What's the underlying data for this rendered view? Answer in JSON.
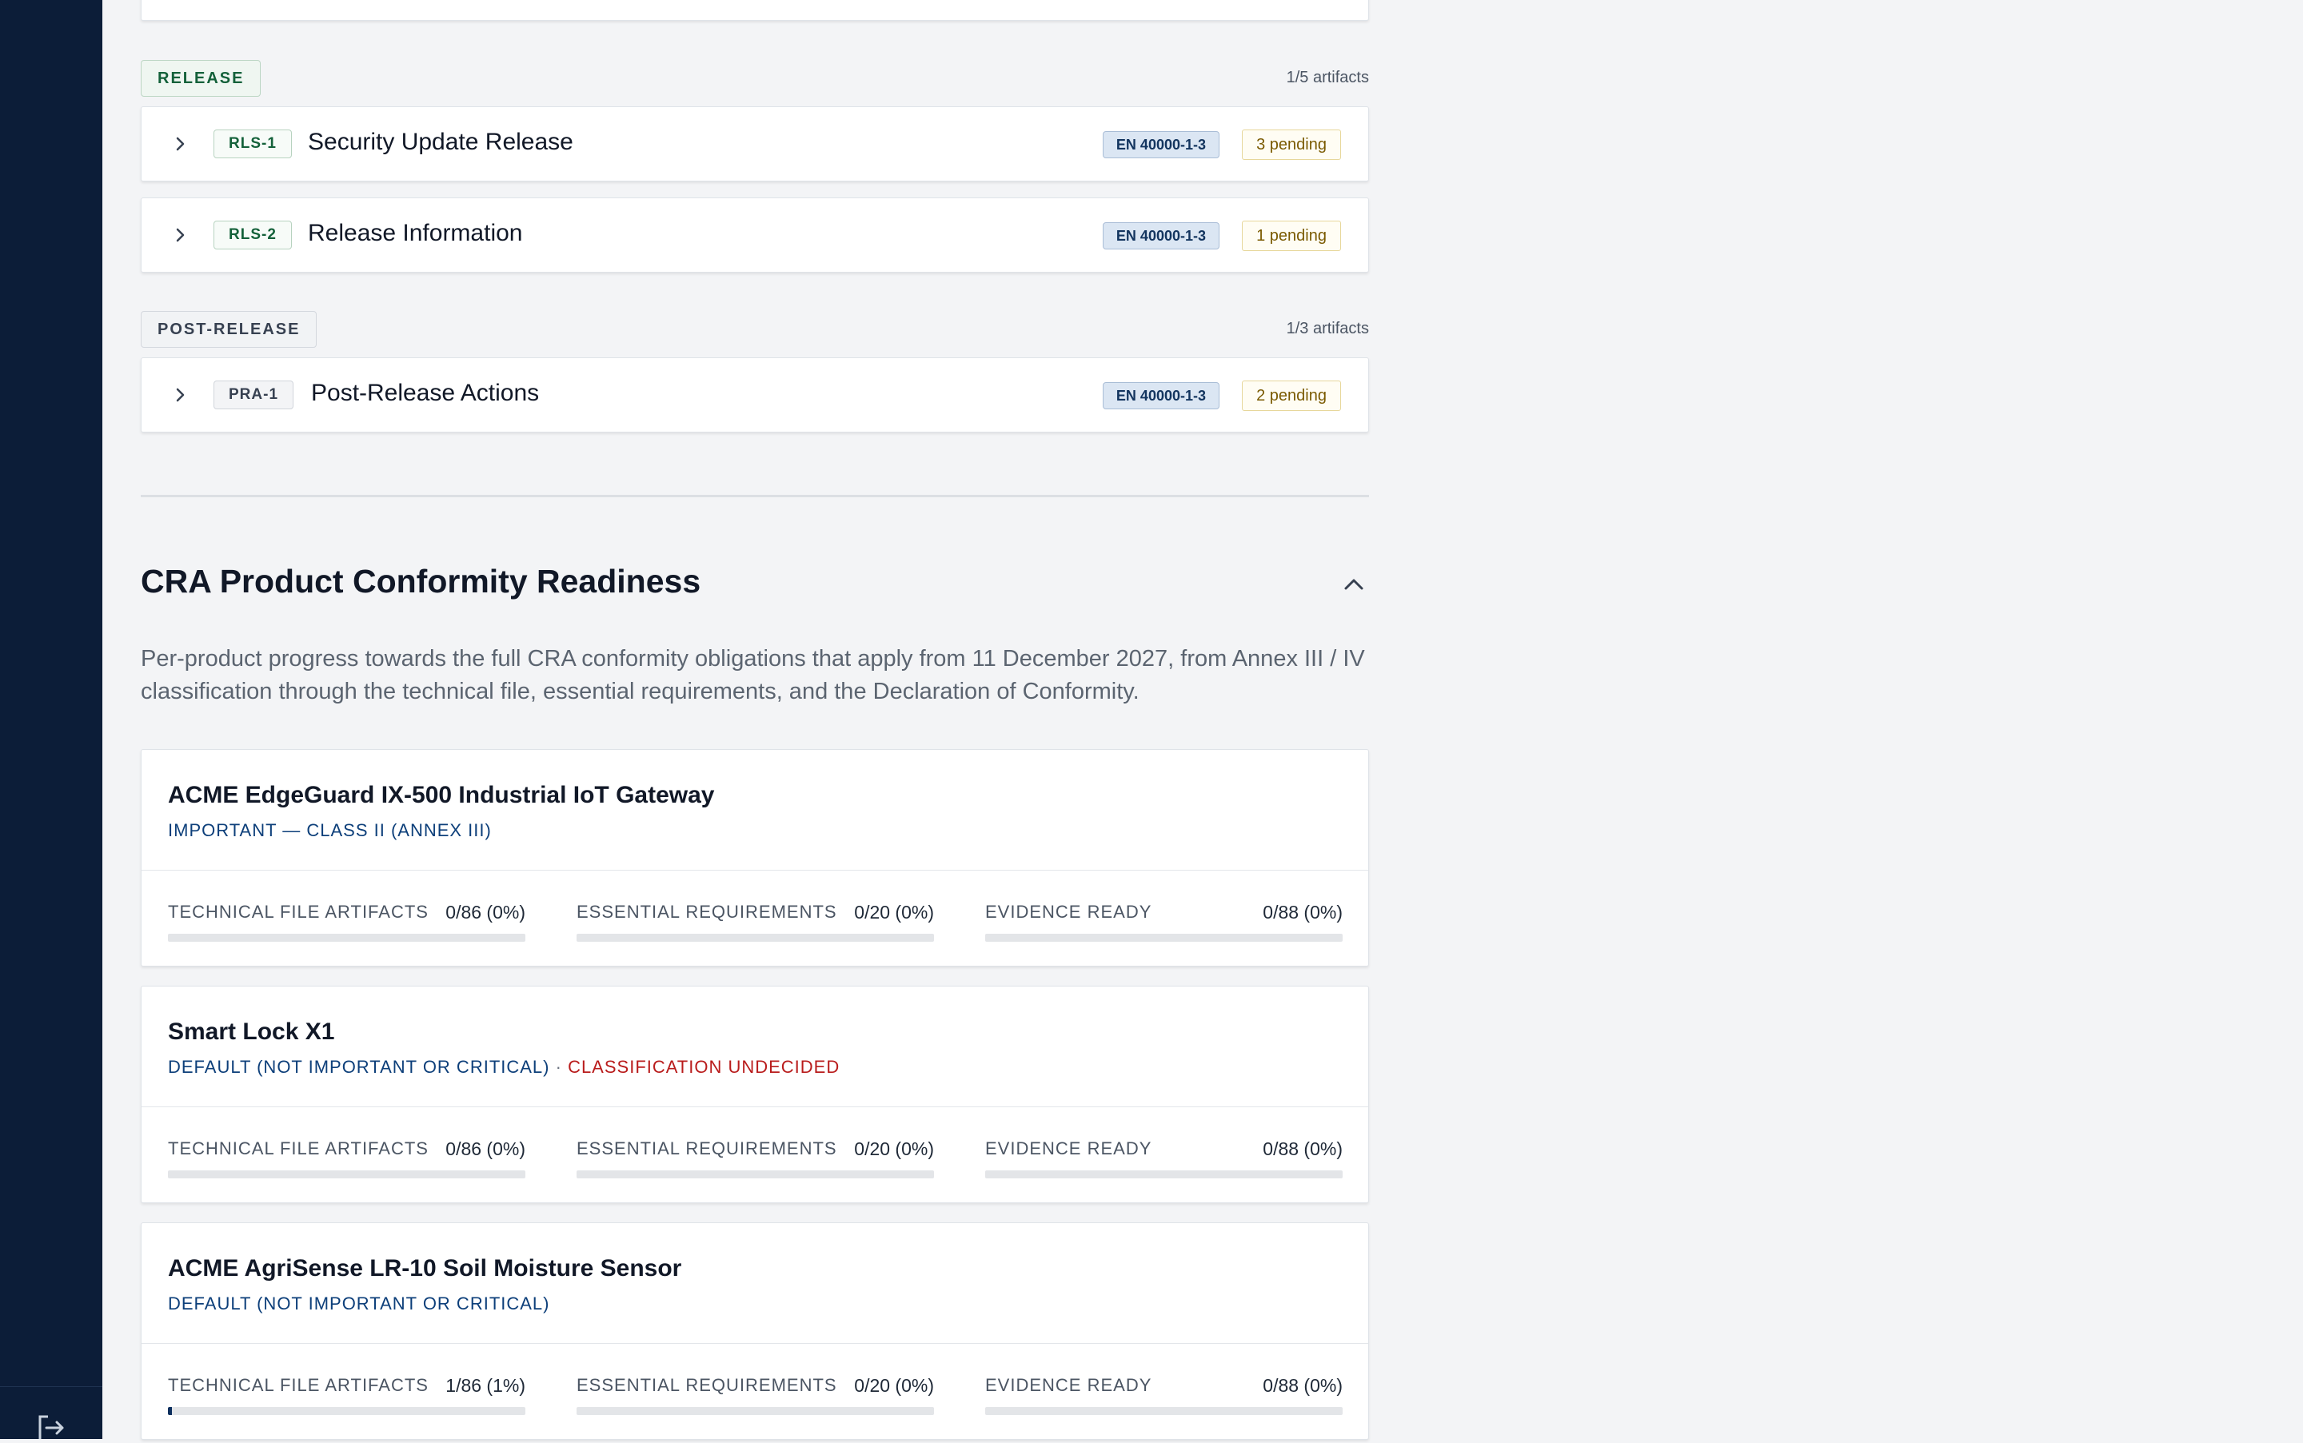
{
  "groups": {
    "release": {
      "label": "RELEASE",
      "count": "1/5 artifacts",
      "items": [
        {
          "code": "RLS-1",
          "title": "Security Update Release",
          "standard": "EN 40000-1-3",
          "pending": "3 pending"
        },
        {
          "code": "RLS-2",
          "title": "Release Information",
          "standard": "EN 40000-1-3",
          "pending": "1 pending"
        }
      ]
    },
    "post_release": {
      "label": "POST-RELEASE",
      "count": "1/3 artifacts",
      "items": [
        {
          "code": "PRA-1",
          "title": "Post-Release Actions",
          "standard": "EN 40000-1-3",
          "pending": "2 pending"
        }
      ]
    }
  },
  "readiness": {
    "title": "CRA Product Conformity Readiness",
    "description": "Per-product progress towards the full CRA conformity obligations that apply from 11 December 2027, from Annex III / IV classification through the technical file, essential requirements, and the Declaration of Conformity.",
    "products": [
      {
        "name": "ACME EdgeGuard IX-500 Industrial IoT Gateway",
        "classification": "IMPORTANT — CLASS II (ANNEX III)",
        "separator": "",
        "warning": "",
        "metrics": [
          {
            "label": "TECHNICAL FILE ARTIFACTS",
            "value": "0/86 (0%)",
            "progress": 0
          },
          {
            "label": "ESSENTIAL REQUIREMENTS",
            "value": "0/20 (0%)",
            "progress": 0
          },
          {
            "label": "EVIDENCE READY",
            "value": "0/88 (0%)",
            "progress": 0
          }
        ]
      },
      {
        "name": "Smart Lock X1",
        "classification": "DEFAULT (NOT IMPORTANT OR CRITICAL)",
        "separator": " · ",
        "warning": "CLASSIFICATION UNDECIDED",
        "metrics": [
          {
            "label": "TECHNICAL FILE ARTIFACTS",
            "value": "0/86 (0%)",
            "progress": 0
          },
          {
            "label": "ESSENTIAL REQUIREMENTS",
            "value": "0/20 (0%)",
            "progress": 0
          },
          {
            "label": "EVIDENCE READY",
            "value": "0/88 (0%)",
            "progress": 0
          }
        ]
      },
      {
        "name": "ACME AgriSense LR-10 Soil Moisture Sensor",
        "classification": "DEFAULT (NOT IMPORTANT OR CRITICAL)",
        "separator": "",
        "warning": "",
        "metrics": [
          {
            "label": "TECHNICAL FILE ARTIFACTS",
            "value": "1/86 (1%)",
            "progress": 0.0116
          },
          {
            "label": "ESSENTIAL REQUIREMENTS",
            "value": "0/20 (0%)",
            "progress": 0
          },
          {
            "label": "EVIDENCE READY",
            "value": "0/88 (0%)",
            "progress": 0
          }
        ]
      }
    ]
  },
  "sidebar": {
    "logout_icon": "logout-icon"
  },
  "colors": {
    "sidebar": "#0c1d38",
    "accent": "#0c2f5e",
    "release_green": "#14613a",
    "warning_red": "#b91c1c"
  }
}
